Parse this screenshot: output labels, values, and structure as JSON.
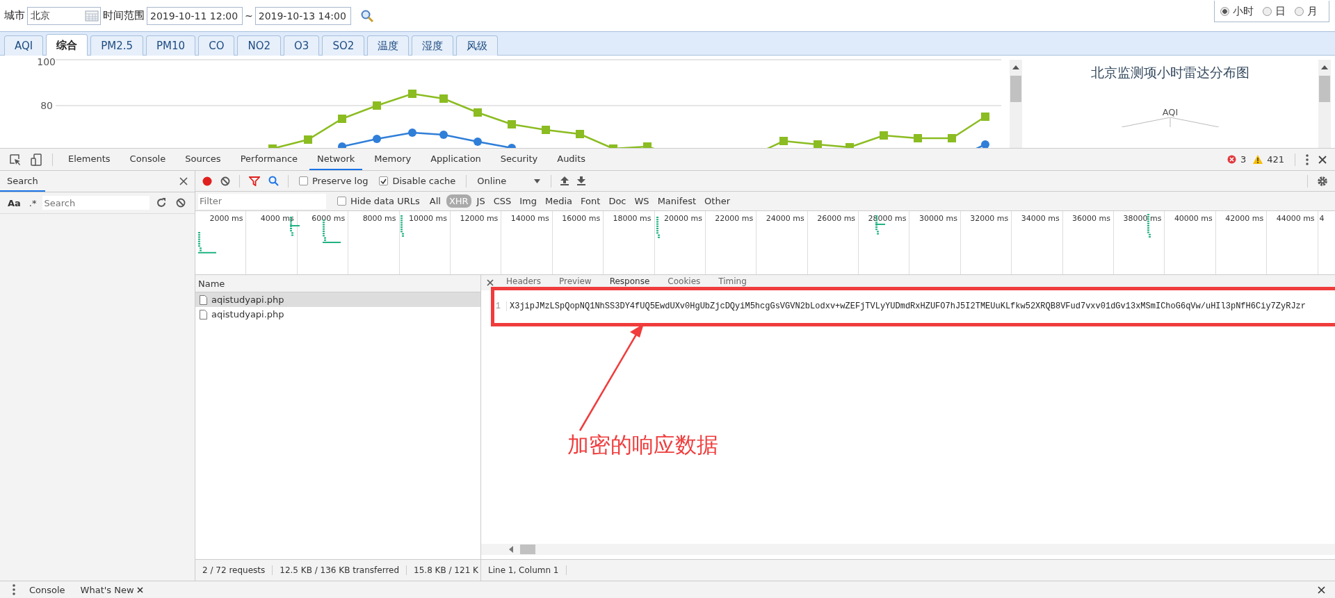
{
  "filter_bar": {
    "city_label": "城市",
    "city": "北京",
    "range_label": "时间范围",
    "start": "2019-10-11 12:00",
    "separator": "~",
    "end": "2019-10-13 14:00",
    "granularity": [
      {
        "label": "小时",
        "selected": true
      },
      {
        "label": "日",
        "selected": false
      },
      {
        "label": "月",
        "selected": false
      }
    ]
  },
  "tabs": [
    {
      "label": "AQI",
      "selected": false
    },
    {
      "label": "综合",
      "selected": true
    },
    {
      "label": "PM2.5",
      "selected": false
    },
    {
      "label": "PM10",
      "selected": false
    },
    {
      "label": "CO",
      "selected": false
    },
    {
      "label": "NO2",
      "selected": false
    },
    {
      "label": "O3",
      "selected": false
    },
    {
      "label": "SO2",
      "selected": false
    },
    {
      "label": "温度",
      "selected": false
    },
    {
      "label": "湿度",
      "selected": false
    },
    {
      "label": "风级",
      "selected": false
    }
  ],
  "trend_chart": {
    "tick_labels": [
      "100",
      "80"
    ]
  },
  "radar_chart": {
    "title": "北京监测项小时雷达分布图",
    "axis_labels": [
      "AQI"
    ]
  },
  "devtools": {
    "tabs": [
      {
        "label": "Elements",
        "selected": false
      },
      {
        "label": "Console",
        "selected": false
      },
      {
        "label": "Sources",
        "selected": false
      },
      {
        "label": "Performance",
        "selected": false
      },
      {
        "label": "Network",
        "selected": true
      },
      {
        "label": "Memory",
        "selected": false
      },
      {
        "label": "Application",
        "selected": false
      },
      {
        "label": "Security",
        "selected": false
      },
      {
        "label": "Audits",
        "selected": false
      }
    ],
    "errors": "3",
    "warnings": "421",
    "sidebar": {
      "title": "Search",
      "case_toggle": "Aa",
      "regex_toggle": ".*",
      "placeholder": "Search"
    },
    "toolbar": {
      "recording": true,
      "preserve_log": {
        "label": "Preserve log",
        "checked": false
      },
      "disable_cache": {
        "label": "Disable cache",
        "checked": true
      },
      "throttling": "Online"
    },
    "filter": {
      "placeholder": "Filter",
      "hide_data_urls": {
        "label": "Hide data URLs",
        "checked": false
      },
      "types": [
        {
          "label": "All",
          "selected": false
        },
        {
          "label": "XHR",
          "selected": true
        },
        {
          "label": "JS",
          "selected": false
        },
        {
          "label": "CSS",
          "selected": false
        },
        {
          "label": "Img",
          "selected": false
        },
        {
          "label": "Media",
          "selected": false
        },
        {
          "label": "Font",
          "selected": false
        },
        {
          "label": "Doc",
          "selected": false
        },
        {
          "label": "WS",
          "selected": false
        },
        {
          "label": "Manifest",
          "selected": false
        },
        {
          "label": "Other",
          "selected": false
        }
      ]
    },
    "timeline": {
      "ticks": [
        "2000 ms",
        "4000 ms",
        "6000 ms",
        "8000 ms",
        "10000 ms",
        "12000 ms",
        "14000 ms",
        "16000 ms",
        "18000 ms",
        "20000 ms",
        "22000 ms",
        "24000 ms",
        "26000 ms",
        "28000 ms",
        "30000 ms",
        "32000 ms",
        "34000 ms",
        "36000 ms",
        "38000 ms",
        "40000 ms",
        "42000 ms",
        "44000 ms",
        "4"
      ]
    },
    "requests": {
      "header": "Name",
      "rows": [
        {
          "name": "aqistudyapi.php",
          "selected": true
        },
        {
          "name": "aqistudyapi.php",
          "selected": false
        }
      ]
    },
    "detail_tabs": [
      {
        "label": "Headers",
        "selected": false
      },
      {
        "label": "Preview",
        "selected": false
      },
      {
        "label": "Response",
        "selected": true
      },
      {
        "label": "Cookies",
        "selected": false
      },
      {
        "label": "Timing",
        "selected": false
      }
    ],
    "response": {
      "line_number": "1",
      "text": "X3jipJMzLSpQopNQ1NhSS3DY4fUQ5EwdUXv0HgUbZjcDQyiM5hcgGsVGVN2bLodxv+wZEFjTVLyYUDmdRxHZUFO7hJ5I2TMEUuKLfkw52XRQB8VFud7vxv01dGv13xMSmIChoG6qVw/uHIl3pNfH6Ciy7ZyRJzr"
    },
    "status": {
      "requests": "2 / 72 requests",
      "transferred": "12.5 KB / 136 KB transferred",
      "resources": "15.8 KB / 121 K",
      "cursor": "Line 1, Column 1"
    },
    "drawer_tabs": [
      {
        "label": "Console",
        "closable": false
      },
      {
        "label": "What's New",
        "closable": true
      }
    ]
  },
  "annotation": {
    "text": "加密的响应数据"
  }
}
